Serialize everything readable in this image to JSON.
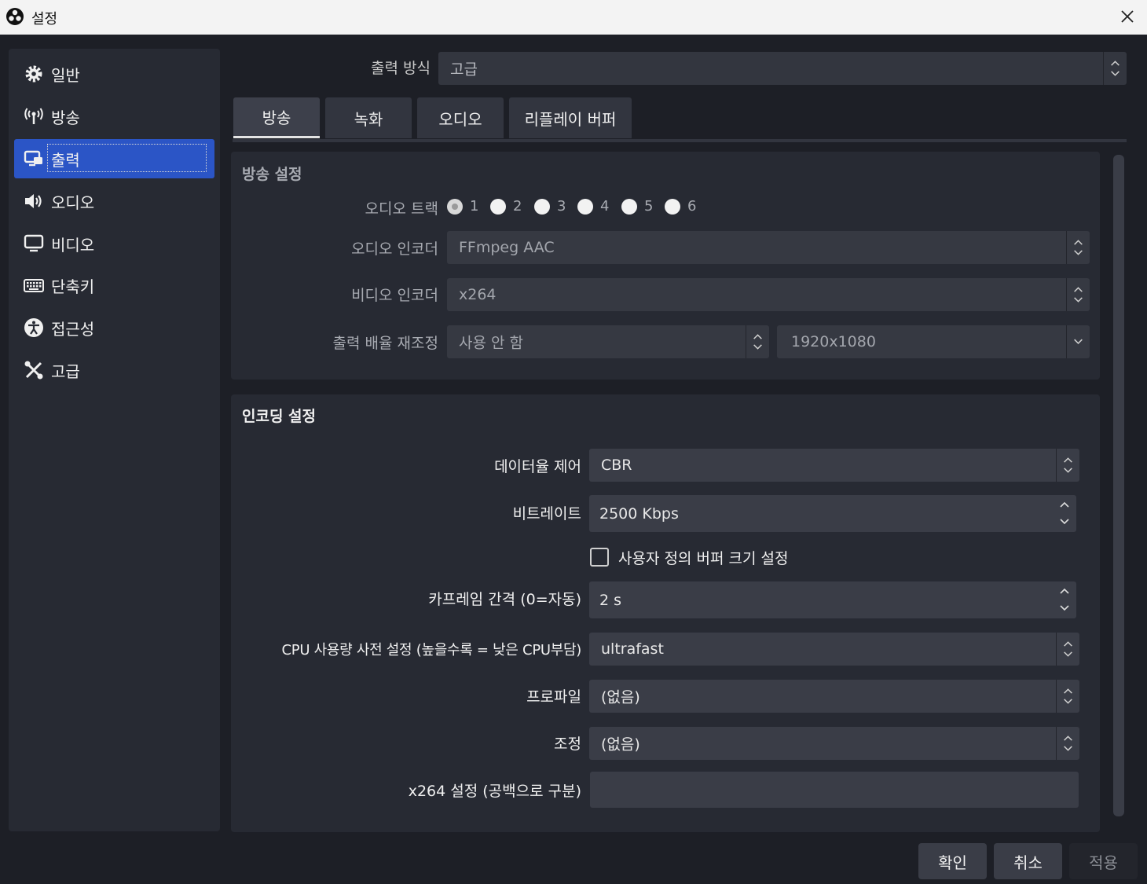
{
  "window": {
    "title": "설정",
    "close_icon": "close-icon"
  },
  "sidebar": {
    "items": [
      {
        "label": "일반",
        "icon": "gear-icon"
      },
      {
        "label": "방송",
        "icon": "antenna-icon"
      },
      {
        "label": "출력",
        "icon": "output-icon",
        "active": true
      },
      {
        "label": "오디오",
        "icon": "speaker-icon"
      },
      {
        "label": "비디오",
        "icon": "monitor-icon"
      },
      {
        "label": "단축키",
        "icon": "keyboard-icon"
      },
      {
        "label": "접근성",
        "icon": "accessibility-icon"
      },
      {
        "label": "고급",
        "icon": "tools-icon"
      }
    ],
    "accent": "#2b55c6"
  },
  "output_mode": {
    "label": "출력 방식",
    "value": "고급"
  },
  "tabs": [
    {
      "label": "방송",
      "active": true
    },
    {
      "label": "녹화"
    },
    {
      "label": "오디오"
    },
    {
      "label": "리플레이 버퍼"
    }
  ],
  "stream_settings": {
    "title": "방송 설정",
    "audio_track": {
      "label": "오디오 트랙",
      "options": [
        "1",
        "2",
        "3",
        "4",
        "5",
        "6"
      ],
      "selected": "1"
    },
    "audio_encoder": {
      "label": "오디오 인코더",
      "value": "FFmpeg AAC"
    },
    "video_encoder": {
      "label": "비디오 인코더",
      "value": "x264"
    },
    "rescale": {
      "label": "출력 배율 재조정",
      "value": "사용 안 함",
      "resolution": "1920x1080"
    }
  },
  "encoding_settings": {
    "title": "인코딩 설정",
    "rate_control": {
      "label": "데이터율 제어",
      "value": "CBR"
    },
    "bitrate": {
      "label": "비트레이트",
      "value": "2500 Kbps"
    },
    "custom_buffer": {
      "label": "사용자 정의 버퍼 크기 설정",
      "checked": false
    },
    "keyframe": {
      "label": "카프레임 간격 (0=자동)",
      "value": "2 s"
    },
    "cpu_preset": {
      "label": "CPU 사용량 사전 설정 (높을수록 = 낮은 CPU부담)",
      "value": "ultrafast"
    },
    "profile": {
      "label": "프로파일",
      "value": "(없음)"
    },
    "tune": {
      "label": "조정",
      "value": "(없음)"
    },
    "x264_opts": {
      "label": "x264 설정 (공백으로 구분)",
      "value": ""
    }
  },
  "buttons": {
    "ok": "확인",
    "cancel": "취소",
    "apply": "적용"
  }
}
